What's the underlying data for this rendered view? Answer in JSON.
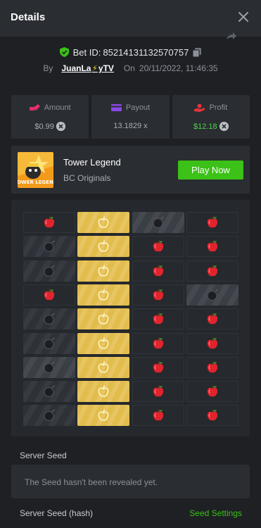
{
  "header": {
    "title": "Details"
  },
  "bet": {
    "label": "Bet ID:",
    "id": "85214131132570757"
  },
  "byline": {
    "by": "By",
    "user_a": "JuanLa",
    "user_bolt": "⚡",
    "user_b": "yTV",
    "on": "On",
    "date": "20/11/2022, 11:46:35"
  },
  "stats": {
    "amount": {
      "label": "Amount",
      "value": "$0.99"
    },
    "payout": {
      "label": "Payout",
      "value": "13.1829 x"
    },
    "profit": {
      "label": "Profit",
      "value": "$12.18"
    }
  },
  "game": {
    "name": "Tower Legend",
    "provider": "BC Originals",
    "play_label": "Play Now",
    "thumb_text": "TOWER\nLEGEND"
  },
  "board": {
    "rows": [
      [
        "apple-dark",
        "apple-gold",
        "bomb-light",
        "apple-dark"
      ],
      [
        "bomb",
        "apple-gold",
        "apple-dark",
        "apple-dark"
      ],
      [
        "bomb",
        "apple-gold",
        "apple-dark",
        "apple-dark"
      ],
      [
        "apple-dark",
        "apple-gold",
        "apple-dark",
        "bomb-light"
      ],
      [
        "bomb",
        "apple-gold",
        "apple-dark",
        "apple-dark"
      ],
      [
        "bomb",
        "apple-gold",
        "apple-dark",
        "apple-dark"
      ],
      [
        "bomb-light",
        "apple-gold",
        "apple-dark",
        "apple-dark"
      ],
      [
        "bomb",
        "apple-gold",
        "apple-dark",
        "apple-dark"
      ],
      [
        "bomb",
        "apple-gold",
        "apple-dark",
        "apple-dark"
      ]
    ]
  },
  "seed": {
    "server_label": "Server Seed",
    "server_text": "The Seed hasn't been revealed yet.",
    "hash_label": "Server Seed (hash)",
    "settings_label": "Seed Settings"
  },
  "colors": {
    "accent_green": "#3bc117",
    "gold": "#e2bd4c",
    "apple_red": "#e0242e",
    "bolt": "#f4c514"
  }
}
